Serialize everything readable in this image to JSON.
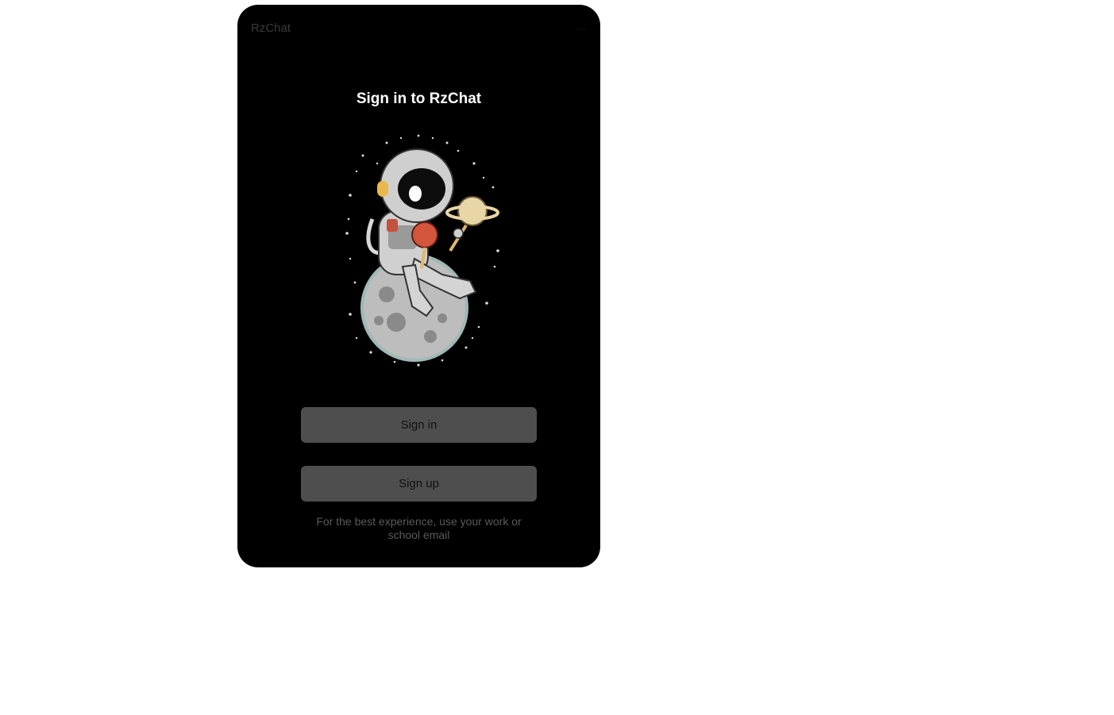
{
  "app": {
    "name": "RzChat",
    "menu_icon": "more-dots-icon"
  },
  "main": {
    "title": "Sign in to RzChat",
    "illustration": "astronaut-on-moon-illustration",
    "sign_in_label": "Sign in",
    "sign_up_label": "Sign up",
    "hint": "For the best experience, use your work or school email"
  },
  "colors": {
    "window_bg": "#000000",
    "button_bg": "#4e4e4e",
    "title_text": "#ffffff",
    "hint_text": "#5a5a5a"
  }
}
